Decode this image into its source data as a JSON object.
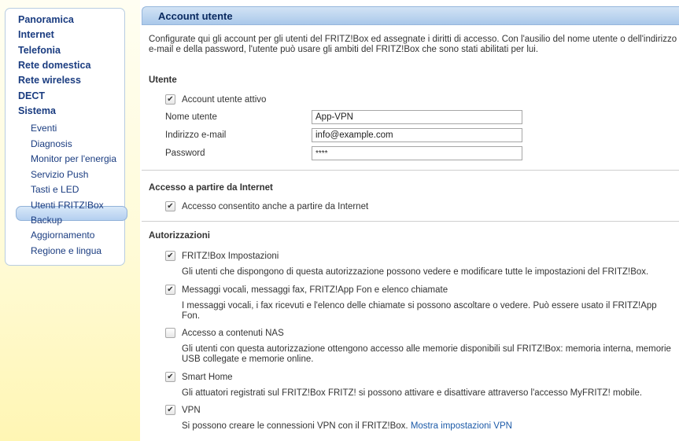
{
  "sidebar": {
    "main_items": [
      "Panoramica",
      "Internet",
      "Telefonia",
      "Rete domestica",
      "Rete wireless",
      "DECT",
      "Sistema"
    ],
    "sub_items": [
      "Eventi",
      "Diagnosis",
      "Monitor per l'energia",
      "Servizio Push",
      "Tasti e LED",
      "Utenti FRITZ!Box",
      "Backup",
      "Aggiornamento",
      "Regione e lingua"
    ],
    "active_sub": "Utenti FRITZ!Box"
  },
  "header": {
    "title": "Account utente"
  },
  "intro": {
    "line1": "Configurate qui gli account per gli utenti del FRITZ!Box ed assegnate i diritti di accesso. Con l'ausilio del nome utente o dell'indirizzo",
    "line2": "e-mail e della password, l'utente può usare gli ambiti del FRITZ!Box che sono stati abilitati per lui."
  },
  "utente": {
    "section_title": "Utente",
    "active_label": "Account utente attivo",
    "active_checked": true,
    "name_label": "Nome utente",
    "name_value": "App-VPN",
    "email_label": "Indirizzo e-mail",
    "email_value": "info@example.com",
    "password_label": "Password",
    "password_value": "****"
  },
  "internet": {
    "section_title": "Accesso a partire da Internet",
    "access_label": "Accesso consentito anche a partire da Internet",
    "access_checked": true
  },
  "permissions": {
    "section_title": "Autorizzazioni",
    "items": [
      {
        "label": "FRITZ!Box Impostazioni",
        "checked": true,
        "desc1": "Gli utenti che dispongono di questa autorizzazione possono vedere e modificare tutte le impostazioni del FRITZ!Box.",
        "desc2": ""
      },
      {
        "label": "Messaggi vocali, messaggi fax, FRITZ!App Fon e elenco chiamate",
        "checked": true,
        "desc1": "I messaggi vocali, i fax ricevuti e l'elenco delle chiamate si possono ascoltare o vedere. Può essere usato il FRITZ!App",
        "desc2": "Fon."
      },
      {
        "label": "Accesso a contenuti NAS",
        "checked": false,
        "desc1": "Gli utenti con questa autorizzazione ottengono accesso alle memorie disponibili sul FRITZ!Box: memoria interna, memorie",
        "desc2": "USB collegate e memorie online."
      },
      {
        "label": "Smart Home",
        "checked": true,
        "desc1": "Gli attuatori registrati sul FRITZ!Box FRITZ! si possono attivare e disattivare attraverso l'accesso MyFRITZ! mobile.",
        "desc2": ""
      },
      {
        "label": "VPN",
        "checked": true,
        "desc1": "Si possono creare le connessioni VPN con il FRITZ!Box.",
        "desc2": "",
        "link": "Mostra impostazioni VPN"
      }
    ]
  },
  "icons": {
    "checkbox_checked": "✔"
  },
  "colors": {
    "nav_text": "#1a3c80",
    "title_bar": "#aac8ea",
    "sidebar_bg": "#fff6b4",
    "link": "#1c5aa8"
  }
}
